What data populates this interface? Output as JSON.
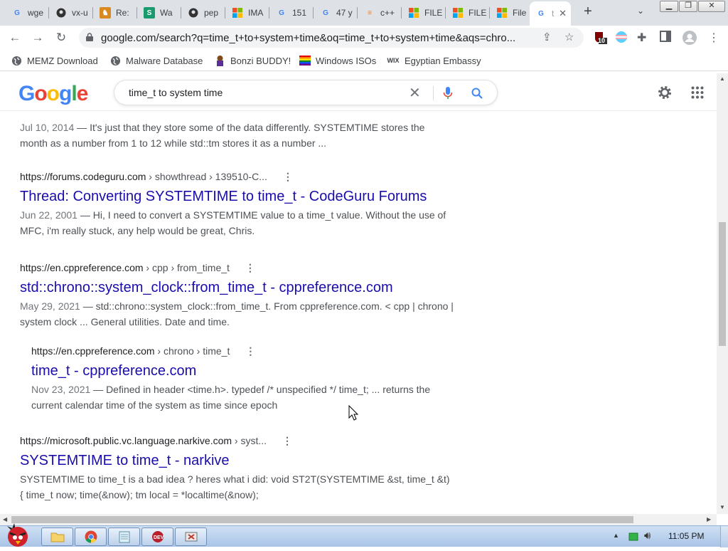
{
  "tabs": [
    {
      "label": "wge",
      "icon": "google-icon"
    },
    {
      "label": "vx-u",
      "icon": "github-icon"
    },
    {
      "label": "Re:",
      "icon": "reddit-icon"
    },
    {
      "label": "Wa",
      "icon": "s-icon"
    },
    {
      "label": "pep",
      "icon": "github-icon"
    },
    {
      "label": "IMA",
      "icon": "windows-icon"
    },
    {
      "label": "151",
      "icon": "google-icon"
    },
    {
      "label": "47 y",
      "icon": "google-icon"
    },
    {
      "label": "c++",
      "icon": "stackoverflow-icon"
    },
    {
      "label": "FILE",
      "icon": "windows-icon"
    },
    {
      "label": "FILE",
      "icon": "windows-icon"
    },
    {
      "label": "File",
      "icon": "windows-icon"
    },
    {
      "label": "t",
      "icon": "google-icon",
      "active": true
    }
  ],
  "toolbar": {
    "url": "google.com/search?q=time_t+to+system+time&oq=time_t+to+system+time&aqs=chro...",
    "extension_badge": "10"
  },
  "bookmarks": [
    {
      "label": "MEMZ Download",
      "icon": "globe-icon"
    },
    {
      "label": "Malware Database",
      "icon": "globe-icon"
    },
    {
      "label": "Bonzi BUDDY!",
      "icon": "bonzi-icon"
    },
    {
      "label": "Windows ISOs",
      "icon": "rainbow-flag-icon"
    },
    {
      "label": "Egyptian Embassy",
      "icon": "wix-icon"
    }
  ],
  "google": {
    "logo": "Google",
    "query": "time_t to system time"
  },
  "results": [
    {
      "date": "Jul 10, 2014",
      "snippet": " — It's just that they store some of the data differently. SYSTEMTIME stores the month as a number from 1 to 12 while std::tm stores it as a number ..."
    },
    {
      "site": "https://forums.codeguru.com",
      "path": " › showthread › 139510-C...",
      "title": "Thread: Converting SYSTEMTIME to time_t - CodeGuru Forums",
      "date": "Jun 22, 2001",
      "snippet": " — Hi, I need to convert a SYSTEMTIME value to a time_t value. Without the use of MFC, i'm really stuck, any help would be great, Chris."
    },
    {
      "site": "https://en.cppreference.com",
      "path": " › cpp › from_time_t",
      "title": "std::chrono::system_clock::from_time_t - cppreference.com",
      "date": "May 29, 2021",
      "snippet": " — std::chrono::system_clock::from_time_t. From cppreference.com. < cpp | chrono | system clock ... General utilities. Date and time."
    },
    {
      "site": "https://en.cppreference.com",
      "path": " › chrono › time_t",
      "title": "time_t - cppreference.com",
      "date": "Nov 23, 2021",
      "snippet": " — Defined in header <time.h>. typedef /* unspecified */ time_t; ... returns the current calendar time of the system as time since epoch"
    },
    {
      "site": "https://microsoft.public.vc.language.narkive.com",
      "path": " › syst...",
      "title": "SYSTEMTIME to time_t - narkive",
      "snippet": "SYSTEMTIME to time_t is a bad idea ? heres what i did: void ST2T(SYSTEMTIME &st, time_t &t) { time_t now; time(&now); tm local = *localtime(&now);"
    }
  ],
  "taskbar": {
    "clock": "11:05 PM"
  }
}
